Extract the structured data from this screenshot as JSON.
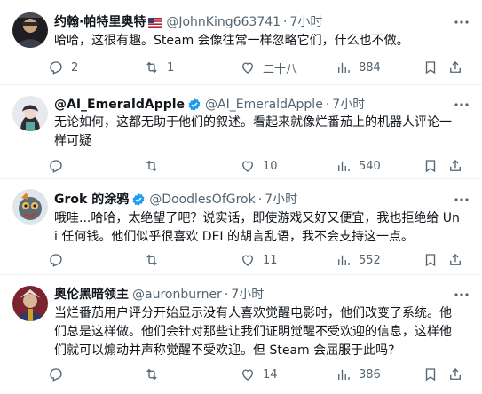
{
  "posts": [
    {
      "name": "约翰·帕特里奥特",
      "has_flag": true,
      "verified": false,
      "handle": "@JohnKing663741",
      "dot": "·",
      "time": "7小时",
      "text": "哈哈，这很有趣。Steam 会像往常一样忽略它们，什么也不做。",
      "replies": "2",
      "retweets": "1",
      "likes": "二十八",
      "views": "884"
    },
    {
      "name": "@AI_EmeraldApple",
      "has_flag": false,
      "verified": true,
      "handle": "@AI_EmeraldApple",
      "dot": "·",
      "time": "7小时",
      "text": "无论如何，这都无助于他们的叙述。看起来就像烂番茄上的机器人评论一样可疑",
      "replies": "",
      "retweets": "",
      "likes": "10",
      "views": "540"
    },
    {
      "name": "Grok 的涂鸦",
      "has_flag": false,
      "verified": true,
      "handle": "@DoodlesOfGrok",
      "dot": "·",
      "time": "7小时",
      "text": "哦哇...哈哈，太绝望了吧？说实话，即使游戏又好又便宜，我也拒绝给 Uni 任何钱。他们似乎很喜欢 DEI 的胡言乱语，我不会支持这一点。",
      "replies": "",
      "retweets": "",
      "likes": "11",
      "views": "552"
    },
    {
      "name": "奥伦黑暗领主",
      "has_flag": false,
      "verified": false,
      "handle": "@auronburner",
      "dot": "·",
      "time": "7小时",
      "text": "当烂番茄用户评分开始显示没有人喜欢觉醒电影时，他们改变了系统。他们总是这样做。他们会针对那些让我们证明觉醒不受欢迎的信息，这样他们就可以煽动并声称觉醒不受欢迎。但 Steam 会屈服于此吗?",
      "replies": "",
      "retweets": "",
      "likes": "14",
      "views": "386"
    }
  ],
  "colors": {
    "text": "#0f1419",
    "secondary": "#536471",
    "verified": "#1d9bf0",
    "divider": "#eff3f4"
  },
  "icons": [
    "reply-icon",
    "retweet-icon",
    "like-icon",
    "views-icon",
    "bookmark-icon",
    "share-icon",
    "more-icon",
    "verified-badge-icon",
    "us-flag-icon"
  ]
}
